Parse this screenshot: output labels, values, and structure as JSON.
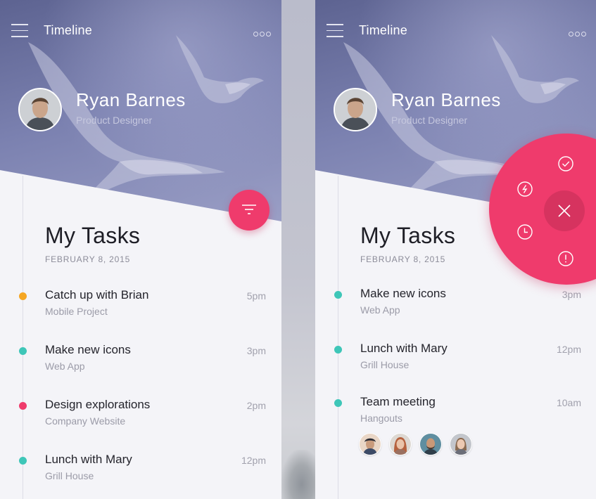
{
  "screens": {
    "left": {
      "header": {
        "title": "Timeline"
      },
      "profile": {
        "name": "Ryan Barnes",
        "role": "Product Designer"
      },
      "tasks_title": "My Tasks",
      "date": "FEBRUARY 8, 2015",
      "tasks": [
        {
          "name": "Catch up with Brian",
          "subtitle": "Mobile Project",
          "time": "5pm",
          "color": "#f5a623"
        },
        {
          "name": "Make new icons",
          "subtitle": "Web App",
          "time": "3pm",
          "color": "#3ec6b8"
        },
        {
          "name": "Design explorations",
          "subtitle": "Company Website",
          "time": "2pm",
          "color": "#ef3b6c"
        },
        {
          "name": "Lunch with Mary",
          "subtitle": "Grill House",
          "time": "12pm",
          "color": "#3ec6b8"
        }
      ]
    },
    "right": {
      "header": {
        "title": "Timeline"
      },
      "profile": {
        "name": "Ryan Barnes",
        "role": "Product Designer"
      },
      "tasks_title": "My Tasks",
      "date": "FEBRUARY 8, 2015",
      "tasks": [
        {
          "name": "Make new icons",
          "subtitle": "Web App",
          "time": "3pm",
          "color": "#3ec6b8"
        },
        {
          "name": "Lunch with Mary",
          "subtitle": "Grill House",
          "time": "12pm",
          "color": "#3ec6b8"
        },
        {
          "name": "Team meeting",
          "subtitle": "Hangouts",
          "time": "10am",
          "color": "#3ec6b8"
        }
      ],
      "fab_menu_options": [
        "check-icon",
        "lightning-icon",
        "clock-icon",
        "alert-icon",
        "close-icon"
      ]
    }
  },
  "colors": {
    "accent": "#ef3b6c",
    "teal": "#3ec6b8",
    "amber": "#f5a623",
    "hero": "#7b81b0",
    "background": "#f4f4f8"
  }
}
